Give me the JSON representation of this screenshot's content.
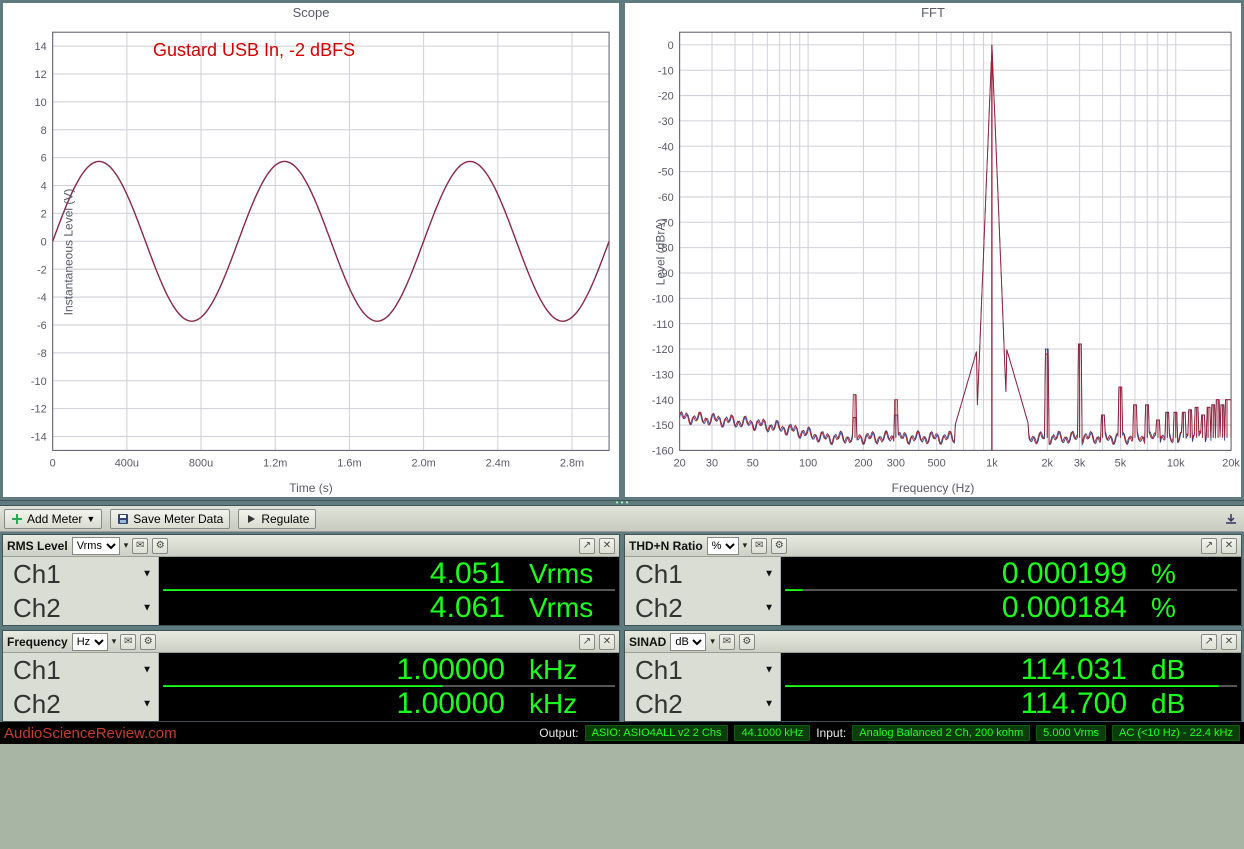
{
  "scope": {
    "title": "Scope",
    "xlabel": "Time (s)",
    "ylabel": "Instantaneous Level (V)",
    "annotation": "Gustard USB In, -2 dBFS",
    "xticks": [
      "0",
      "400u",
      "800u",
      "1.2m",
      "1.6m",
      "2.0m",
      "2.4m",
      "2.8m"
    ],
    "yticks": [
      "14",
      "12",
      "10",
      "8",
      "6",
      "4",
      "2",
      "0",
      "-2",
      "-4",
      "-6",
      "-8",
      "-10",
      "-12",
      "-14"
    ]
  },
  "fft": {
    "title": "FFT",
    "xlabel": "Frequency (Hz)",
    "ylabel": "Level (dBrA)",
    "xticks": [
      "20",
      "30",
      "50",
      "100",
      "200",
      "300",
      "500",
      "1k",
      "2k",
      "3k",
      "5k",
      "10k",
      "20k"
    ],
    "yticks": [
      "0",
      "-10",
      "-20",
      "-30",
      "-40",
      "-50",
      "-60",
      "-70",
      "-80",
      "-90",
      "-100",
      "-110",
      "-120",
      "-130",
      "-140",
      "-150",
      "-160"
    ]
  },
  "toolbar": {
    "add_meter": "Add Meter",
    "save_meter": "Save Meter Data",
    "regulate": "Regulate"
  },
  "meters": {
    "rms": {
      "title": "RMS Level",
      "unit_sel": "Vrms",
      "ch1_label": "Ch1",
      "ch1_value": "4.051",
      "ch1_unit": "Vrms",
      "ch1_fill": 77,
      "ch2_label": "Ch2",
      "ch2_value": "4.061",
      "ch2_unit": "Vrms",
      "ch2_fill": 77
    },
    "thdn": {
      "title": "THD+N Ratio",
      "unit_sel": "%",
      "ch1_label": "Ch1",
      "ch1_value": "0.000199",
      "ch1_unit": "%",
      "ch1_fill": 4,
      "ch2_label": "Ch2",
      "ch2_value": "0.000184",
      "ch2_unit": "%",
      "ch2_fill": 4
    },
    "freq": {
      "title": "Frequency",
      "unit_sel": "Hz",
      "ch1_label": "Ch1",
      "ch1_value": "1.00000",
      "ch1_unit": "kHz",
      "ch1_fill": 62,
      "ch2_label": "Ch2",
      "ch2_value": "1.00000",
      "ch2_unit": "kHz",
      "ch2_fill": 62
    },
    "sinad": {
      "title": "SINAD",
      "unit_sel": "dB",
      "ch1_label": "Ch1",
      "ch1_value": "114.031",
      "ch1_unit": "dB",
      "ch1_fill": 96,
      "ch2_label": "Ch2",
      "ch2_value": "114.700",
      "ch2_unit": "dB",
      "ch2_fill": 96
    }
  },
  "status": {
    "watermark": "AudioScienceReview.com",
    "out_label": "Output:",
    "out_device": "ASIO: ASIO4ALL v2 2 Chs",
    "out_rate": "44.1000 kHz",
    "in_label": "Input:",
    "in_device": "Analog Balanced 2 Ch, 200 kohm",
    "in_level": "5.000 Vrms",
    "in_bw": "AC (<10 Hz) - 22.4 kHz"
  },
  "chart_data": [
    {
      "type": "line",
      "title": "Scope",
      "xlabel": "Time (s)",
      "ylabel": "Instantaneous Level (V)",
      "xlim": [
        0,
        0.003
      ],
      "ylim": [
        -15,
        15
      ],
      "annotation": "Gustard USB In, -2 dBFS",
      "series": [
        {
          "name": "Ch1",
          "function": "5.73*sin(2*pi*1000*t)",
          "amplitude_v": 5.73,
          "frequency_hz": 1000
        }
      ]
    },
    {
      "type": "line",
      "title": "FFT",
      "xlabel": "Frequency (Hz)",
      "ylabel": "Level (dBrA)",
      "xscale": "log",
      "xlim": [
        20,
        20000
      ],
      "ylim": [
        -160,
        5
      ],
      "series": [
        {
          "name": "Ch1",
          "noise_floor_db": -155,
          "fundamental": {
            "freq_hz": 1000,
            "level_db": 0
          },
          "low_freq_hump": [
            {
              "freq_hz": 20,
              "level_db": -148
            },
            {
              "freq_hz": 30,
              "level_db": -150
            },
            {
              "freq_hz": 50,
              "level_db": -153
            },
            {
              "freq_hz": 100,
              "level_db": -155
            }
          ],
          "spurs": [
            {
              "freq_hz": 180,
              "level_db": -147
            },
            {
              "freq_hz": 300,
              "level_db": -146
            },
            {
              "freq_hz": 2000,
              "level_db": -120
            },
            {
              "freq_hz": 3000,
              "level_db": -118
            },
            {
              "freq_hz": 4000,
              "level_db": -146
            },
            {
              "freq_hz": 5000,
              "level_db": -135
            },
            {
              "freq_hz": 6000,
              "level_db": -142
            },
            {
              "freq_hz": 7000,
              "level_db": -142
            },
            {
              "freq_hz": 8000,
              "level_db": -148
            },
            {
              "freq_hz": 9000,
              "level_db": -145
            },
            {
              "freq_hz": 10000,
              "level_db": -145
            },
            {
              "freq_hz": 11000,
              "level_db": -145
            },
            {
              "freq_hz": 12000,
              "level_db": -144
            },
            {
              "freq_hz": 13000,
              "level_db": -143
            },
            {
              "freq_hz": 14000,
              "level_db": -146
            },
            {
              "freq_hz": 15000,
              "level_db": -143
            },
            {
              "freq_hz": 16000,
              "level_db": -142
            },
            {
              "freq_hz": 17000,
              "level_db": -140
            },
            {
              "freq_hz": 18000,
              "level_db": -142
            },
            {
              "freq_hz": 19000,
              "level_db": -140
            },
            {
              "freq_hz": 20000,
              "level_db": -140
            }
          ]
        },
        {
          "name": "Ch2",
          "noise_floor_db": -155,
          "fundamental": {
            "freq_hz": 1000,
            "level_db": 0
          },
          "low_freq_hump": [
            {
              "freq_hz": 20,
              "level_db": -145
            },
            {
              "freq_hz": 30,
              "level_db": -147
            },
            {
              "freq_hz": 50,
              "level_db": -150
            },
            {
              "freq_hz": 100,
              "level_db": -154
            }
          ],
          "spurs": [
            {
              "freq_hz": 180,
              "level_db": -138
            },
            {
              "freq_hz": 300,
              "level_db": -140
            },
            {
              "freq_hz": 2000,
              "level_db": -122
            },
            {
              "freq_hz": 3000,
              "level_db": -118
            },
            {
              "freq_hz": 4000,
              "level_db": -146
            },
            {
              "freq_hz": 5000,
              "level_db": -135
            },
            {
              "freq_hz": 6000,
              "level_db": -142
            },
            {
              "freq_hz": 7000,
              "level_db": -142
            },
            {
              "freq_hz": 8000,
              "level_db": -148
            },
            {
              "freq_hz": 9000,
              "level_db": -145
            },
            {
              "freq_hz": 10000,
              "level_db": -145
            },
            {
              "freq_hz": 11000,
              "level_db": -145
            },
            {
              "freq_hz": 12000,
              "level_db": -144
            },
            {
              "freq_hz": 13000,
              "level_db": -143
            },
            {
              "freq_hz": 14000,
              "level_db": -146
            },
            {
              "freq_hz": 15000,
              "level_db": -143
            },
            {
              "freq_hz": 16000,
              "level_db": -142
            },
            {
              "freq_hz": 17000,
              "level_db": -140
            },
            {
              "freq_hz": 18000,
              "level_db": -142
            },
            {
              "freq_hz": 19000,
              "level_db": -140
            },
            {
              "freq_hz": 20000,
              "level_db": -140
            }
          ]
        }
      ]
    }
  ]
}
